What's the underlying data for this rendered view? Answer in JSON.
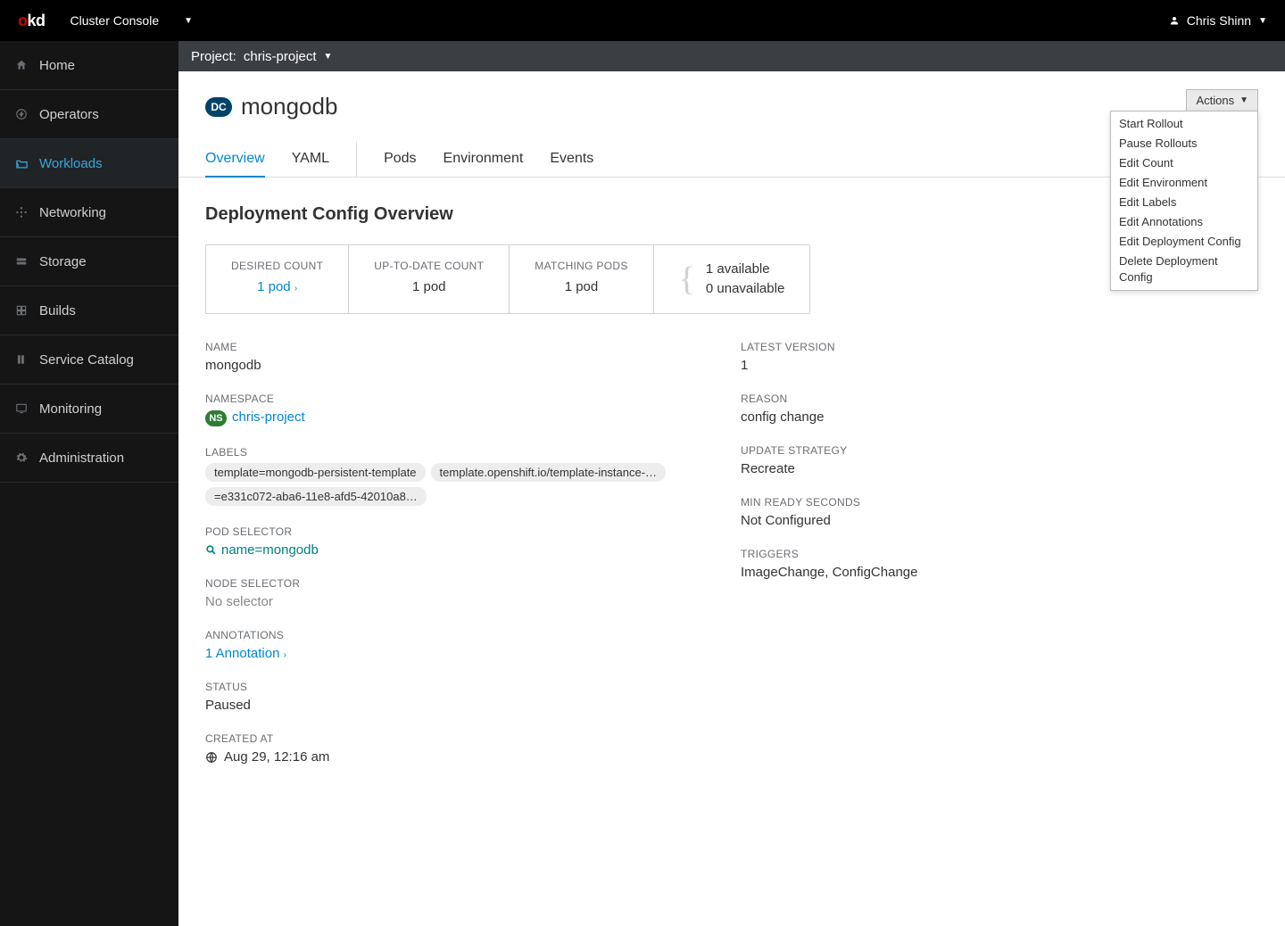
{
  "topbar": {
    "console_label": "Cluster Console",
    "user_name": "Chris Shinn"
  },
  "sidebar": {
    "items": [
      {
        "label": "Home"
      },
      {
        "label": "Operators"
      },
      {
        "label": "Workloads"
      },
      {
        "label": "Networking"
      },
      {
        "label": "Storage"
      },
      {
        "label": "Builds"
      },
      {
        "label": "Service Catalog"
      },
      {
        "label": "Monitoring"
      },
      {
        "label": "Administration"
      }
    ]
  },
  "project_bar": {
    "label": "Project:",
    "value": "chris-project"
  },
  "header": {
    "badge": "DC",
    "title": "mongodb",
    "actions_label": "Actions"
  },
  "actions_menu": [
    "Start Rollout",
    "Pause Rollouts",
    "Edit Count",
    "Edit Environment",
    "Edit Labels",
    "Edit Annotations",
    "Edit Deployment Config",
    "Delete Deployment Config"
  ],
  "tabs": [
    "Overview",
    "YAML",
    "Pods",
    "Environment",
    "Events"
  ],
  "section_title": "Deployment Config Overview",
  "stats": {
    "desired": {
      "label": "DESIRED COUNT",
      "value": "1 pod"
    },
    "uptodate": {
      "label": "UP-TO-DATE COUNT",
      "value": "1 pod"
    },
    "matching": {
      "label": "MATCHING PODS",
      "value": "1 pod"
    },
    "avail": {
      "available": "1 available",
      "unavailable": "0 unavailable"
    }
  },
  "left": {
    "name": {
      "label": "Name",
      "value": "mongodb"
    },
    "namespace": {
      "label": "Namespace",
      "badge": "NS",
      "value": "chris-project"
    },
    "labels": {
      "label": "Labels",
      "chips": [
        "template=mongodb-persistent-template",
        "template.openshift.io/template-instance-…",
        "=e331c072-aba6-11e8-afd5-42010a8…"
      ]
    },
    "pod_selector": {
      "label": "Pod Selector",
      "value": "name=mongodb"
    },
    "node_selector": {
      "label": "Node Selector",
      "value": "No selector"
    },
    "annotations": {
      "label": "Annotations",
      "value": "1 Annotation"
    },
    "status": {
      "label": "Status",
      "value": "Paused"
    },
    "created": {
      "label": "Created At",
      "value": "Aug 29, 12:16 am"
    }
  },
  "right": {
    "latest": {
      "label": "Latest Version",
      "value": "1"
    },
    "reason": {
      "label": "Reason",
      "value": "config change"
    },
    "strategy": {
      "label": "Update Strategy",
      "value": "Recreate"
    },
    "min_ready": {
      "label": "Min Ready Seconds",
      "value": "Not Configured"
    },
    "triggers": {
      "label": "Triggers",
      "value": "ImageChange, ConfigChange"
    }
  }
}
